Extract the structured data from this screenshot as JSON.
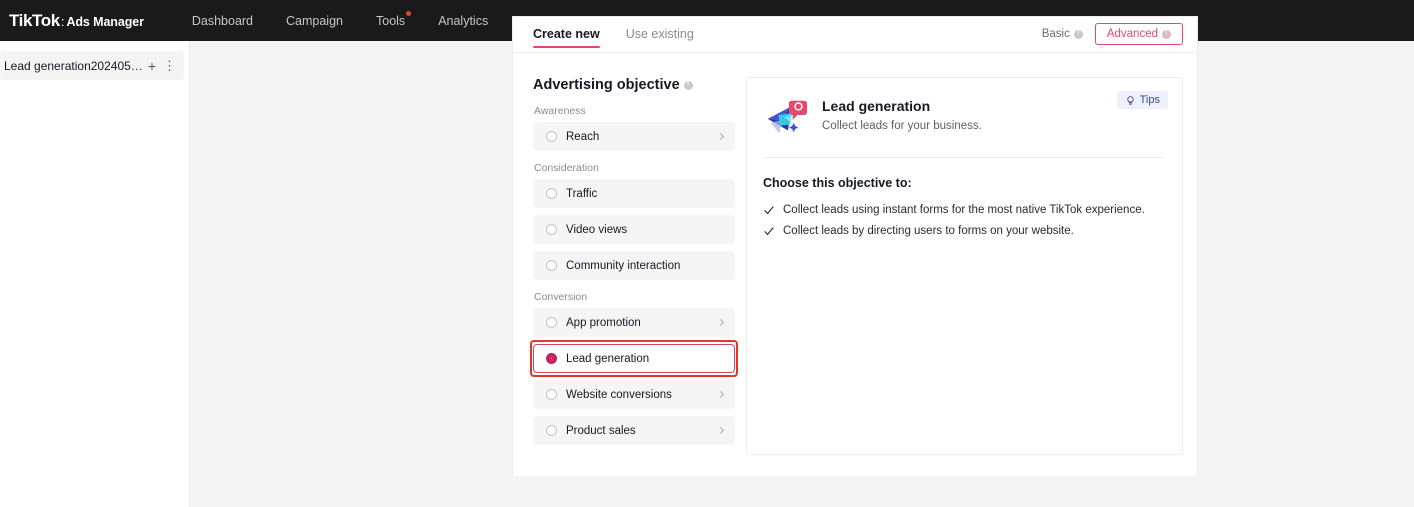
{
  "topnav": {
    "brand_tiktok": "TikTok",
    "brand_colon": ":",
    "brand_ads": "Ads Manager",
    "items": [
      {
        "label": "Dashboard",
        "badge": false
      },
      {
        "label": "Campaign",
        "badge": false
      },
      {
        "label": "Tools",
        "badge": true
      },
      {
        "label": "Analytics",
        "badge": false
      }
    ]
  },
  "sidebar": {
    "tab_label": "Lead generation2024052...",
    "add_label": "+",
    "more_label": "⋮"
  },
  "panel": {
    "tabs": [
      {
        "label": "Create new",
        "active": true
      },
      {
        "label": "Use existing",
        "active": false
      }
    ],
    "mode": {
      "basic_label": "Basic",
      "advanced_label": "Advanced",
      "selected": "Advanced",
      "accent": "#e8476d"
    }
  },
  "objective": {
    "title": "Advertising objective",
    "groups": [
      {
        "label": "Awareness",
        "options": [
          {
            "label": "Reach",
            "selected": false,
            "chevron": true
          }
        ]
      },
      {
        "label": "Consideration",
        "options": [
          {
            "label": "Traffic",
            "selected": false,
            "chevron": false
          },
          {
            "label": "Video views",
            "selected": false,
            "chevron": false
          },
          {
            "label": "Community interaction",
            "selected": false,
            "chevron": false
          }
        ]
      },
      {
        "label": "Conversion",
        "options": [
          {
            "label": "App promotion",
            "selected": false,
            "chevron": true
          },
          {
            "label": "Lead generation",
            "selected": true,
            "chevron": false,
            "highlighted": true
          },
          {
            "label": "Website conversions",
            "selected": false,
            "chevron": true
          },
          {
            "label": "Product sales",
            "selected": false,
            "chevron": true
          }
        ]
      }
    ]
  },
  "detail": {
    "title": "Lead generation",
    "subtitle": "Collect leads for your business.",
    "tips_label": "Tips",
    "choose_title": "Choose this objective to:",
    "bullets": [
      "Collect leads using instant forms for the most native TikTok experience.",
      "Collect leads by directing users to forms on your website."
    ]
  },
  "colors": {
    "accent_pink": "#e8476d",
    "selected_pink": "#c6215a",
    "annotation_red": "#e03a22",
    "nav_background": "#1a1a1a",
    "workspace_background": "#f4f4f4"
  }
}
